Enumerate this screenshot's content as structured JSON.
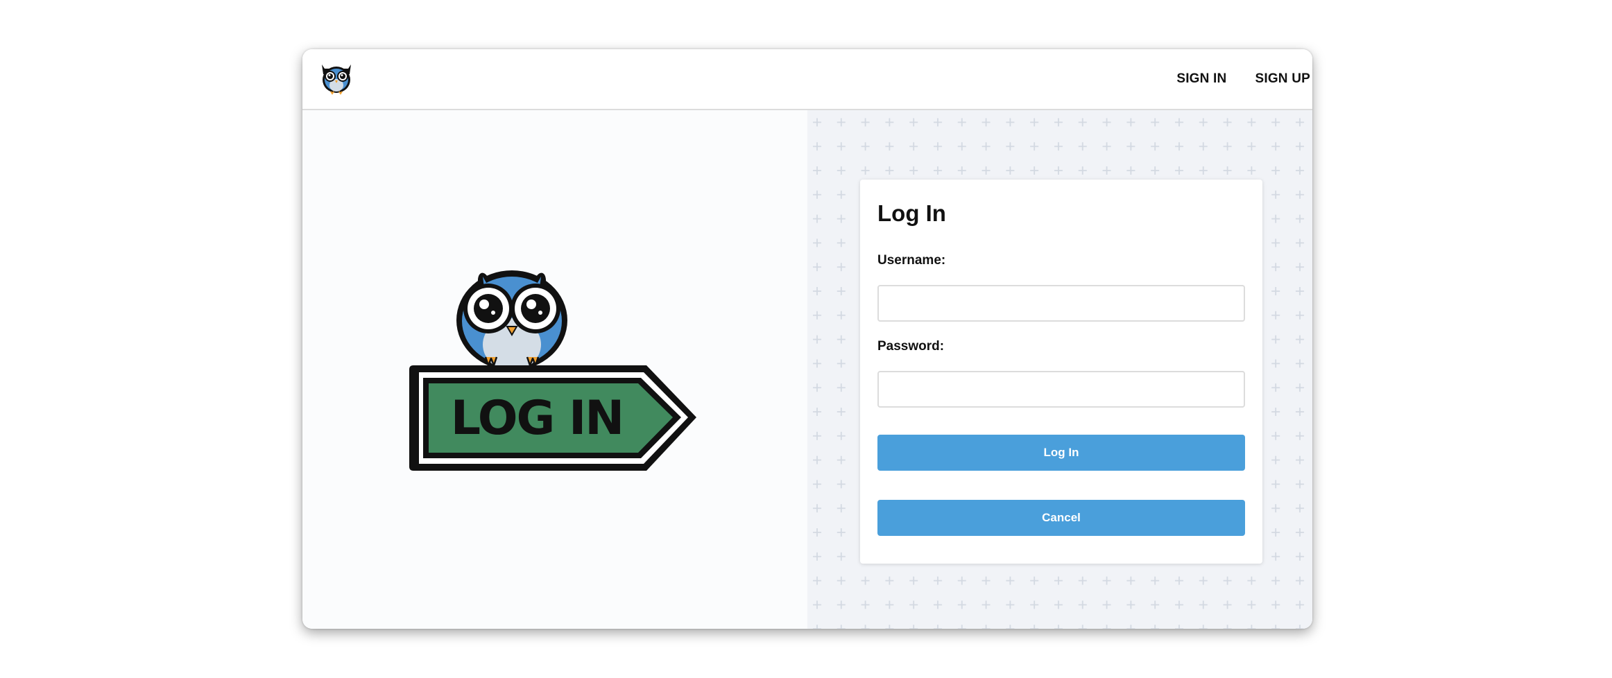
{
  "header": {
    "logo_icon": "owl-icon",
    "nav": [
      {
        "label": "SIGN IN"
      },
      {
        "label": "SIGN UP"
      }
    ]
  },
  "hero": {
    "icon": "owl-sign-illustration",
    "sign_text": "LOG IN",
    "sign_color": "#418a5e",
    "owl_color": "#4a90d0"
  },
  "login_form": {
    "title": "Log In",
    "username_label": "Username:",
    "username_value": "",
    "password_label": "Password:",
    "password_value": "",
    "login_button": "Log In",
    "cancel_button": "Cancel"
  },
  "colors": {
    "accent": "#4a9fdb",
    "panel_bg": "#f1f3f7",
    "pattern": "#d7dde6"
  }
}
